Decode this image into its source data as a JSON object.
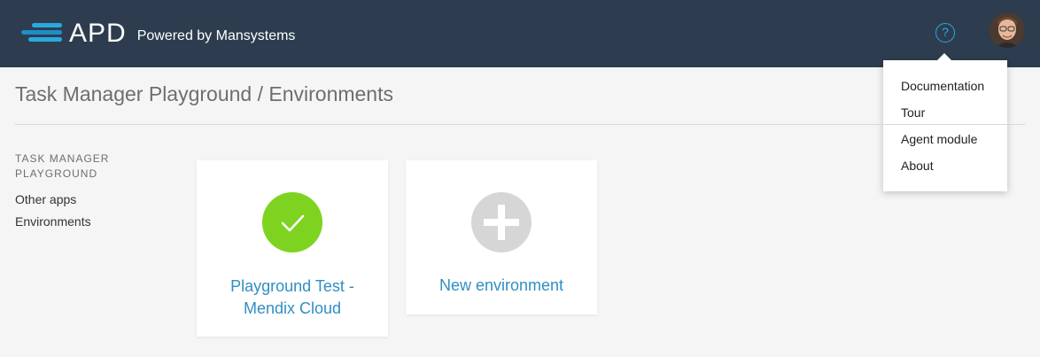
{
  "header": {
    "logo_text": "APD",
    "logo_subtitle": "Powered by Mansystems",
    "help_label": "?"
  },
  "help_menu": {
    "items": [
      {
        "label": "Documentation"
      },
      {
        "label": "Tour"
      },
      {
        "label": "Agent module"
      },
      {
        "label": "About"
      }
    ]
  },
  "page": {
    "title": "Task Manager Playground / Environments"
  },
  "sidebar": {
    "heading": "TASK MANAGER PLAYGROUND",
    "items": [
      {
        "label": "Other apps"
      },
      {
        "label": "Environments"
      }
    ]
  },
  "cards": [
    {
      "icon": "check-icon",
      "status_color": "#7ed321",
      "label": "Playground Test - Mendix Cloud"
    },
    {
      "icon": "plus-icon",
      "status_color": "#d6d6d6",
      "label": "New environment"
    }
  ],
  "colors": {
    "header_bg": "#2d3d4f",
    "accent": "#29a9e1",
    "link": "#2f8fc4"
  }
}
